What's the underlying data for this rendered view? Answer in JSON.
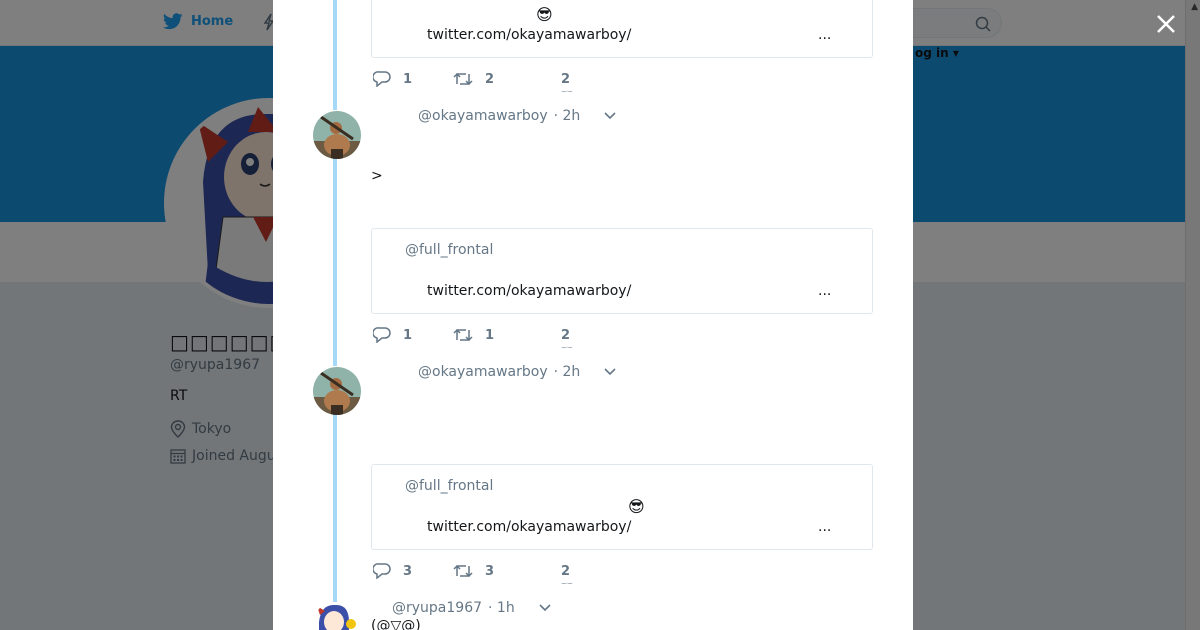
{
  "nav": {
    "home_label": "Home",
    "login_label": "og in ▾"
  },
  "profile": {
    "name": "□□□□□□□□□□□",
    "handle": "@ryupa1967",
    "bio": "RT",
    "location": "Tokyo",
    "joined": "Joined Augu"
  },
  "modal": {
    "tweets": [
      {
        "card": {
          "emoji": "😎",
          "link": "twitter.com/okayamawarboy/",
          "more": "..."
        },
        "actions": {
          "replies": "1",
          "retweets": "2",
          "likes": "2"
        }
      },
      {
        "handle": "@okayamawarboy",
        "time": "· 2h",
        "text": ">",
        "card": {
          "author": "@full_frontal",
          "link": "twitter.com/okayamawarboy/",
          "more": "..."
        },
        "actions": {
          "replies": "1",
          "retweets": "1",
          "likes": "2"
        }
      },
      {
        "handle": "@okayamawarboy",
        "time": "· 2h",
        "card": {
          "author": "@full_frontal",
          "emoji": "😎",
          "link": "twitter.com/okayamawarboy/",
          "more": "..."
        },
        "actions": {
          "replies": "3",
          "retweets": "3",
          "likes": "2"
        }
      },
      {
        "handle": "@ryupa1967",
        "time": "· 1h",
        "text": "(@▽@)"
      }
    ]
  },
  "colors": {
    "twitter_blue": "#1da1f2",
    "banner": "#1b95e0",
    "thread_line": "#a5d9f7",
    "secondary_text": "#657786"
  }
}
